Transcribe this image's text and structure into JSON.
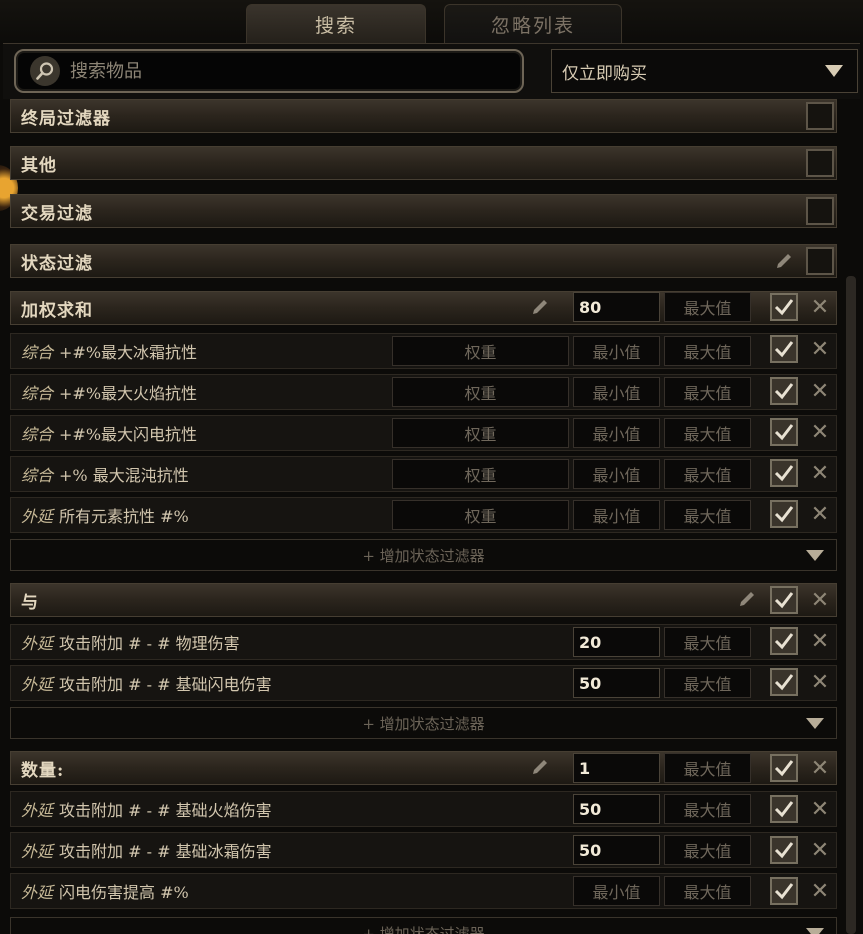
{
  "tabs": [
    {
      "label": "搜索"
    },
    {
      "label": "忽略列表"
    }
  ],
  "search": {
    "placeholder": "搜索物品",
    "value": ""
  },
  "type_select": {
    "selected": "仅立即购买"
  },
  "categories": [
    {
      "label": "终局过滤器",
      "checked": false
    },
    {
      "label": "其他",
      "checked": false
    },
    {
      "label": "交易过滤",
      "checked": false
    },
    {
      "label": "状态过滤",
      "checked": false
    }
  ],
  "stat_groups": [
    {
      "label": "加权求和",
      "min": "80",
      "max_placeholder": "最大值",
      "checked": true,
      "rows": [
        {
          "prefix": "综合",
          "text": "+#%最大冰霜抗性",
          "weight": "权重",
          "min": "最小值",
          "max": "最大值",
          "checked": true
        },
        {
          "prefix": "综合",
          "text": "+#%最大火焰抗性",
          "weight": "权重",
          "min": "最小值",
          "max": "最大值",
          "checked": true
        },
        {
          "prefix": "综合",
          "text": "+#%最大闪电抗性",
          "weight": "权重",
          "min": "最小值",
          "max": "最大值",
          "checked": true
        },
        {
          "prefix": "综合",
          "text": "+% 最大混沌抗性",
          "weight": "权重",
          "min": "最小值",
          "max": "最大值",
          "checked": true
        },
        {
          "prefix": "外延",
          "text": "所有元素抗性 #%",
          "weight": "权重",
          "min": "最小值",
          "max": "最大值",
          "checked": true
        }
      ],
      "add_label": "+ 增加状态过滤器"
    },
    {
      "label": "与",
      "checked": true,
      "rows": [
        {
          "prefix": "外延",
          "text": "攻击附加 # - # 物理伤害",
          "min_value": "20",
          "max": "最大值",
          "checked": true
        },
        {
          "prefix": "外延",
          "text": "攻击附加 # - # 基础闪电伤害",
          "min_value": "50",
          "max": "最大值",
          "checked": true
        }
      ],
      "add_label": "+ 增加状态过滤器"
    },
    {
      "label": "数量:",
      "min": "1",
      "max_placeholder": "最大值",
      "checked": true,
      "rows": [
        {
          "prefix": "外延",
          "text": "攻击附加 # - # 基础火焰伤害",
          "min_value": "50",
          "max": "最大值",
          "checked": true
        },
        {
          "prefix": "外延",
          "text": "攻击附加 # - # 基础冰霜伤害",
          "min_value": "50",
          "max": "最大值",
          "checked": true
        },
        {
          "prefix": "外延",
          "text": "闪电伤害提高 #%",
          "min": "最小值",
          "max": "最大值",
          "checked": true
        }
      ],
      "add_label": "+ 增加状态过滤器"
    }
  ],
  "icons": {
    "search": "magnifier-icon",
    "dropdown": "triangle-down-icon",
    "edit": "pencil-icon",
    "check": "checkmark-icon",
    "remove": "x-icon"
  }
}
